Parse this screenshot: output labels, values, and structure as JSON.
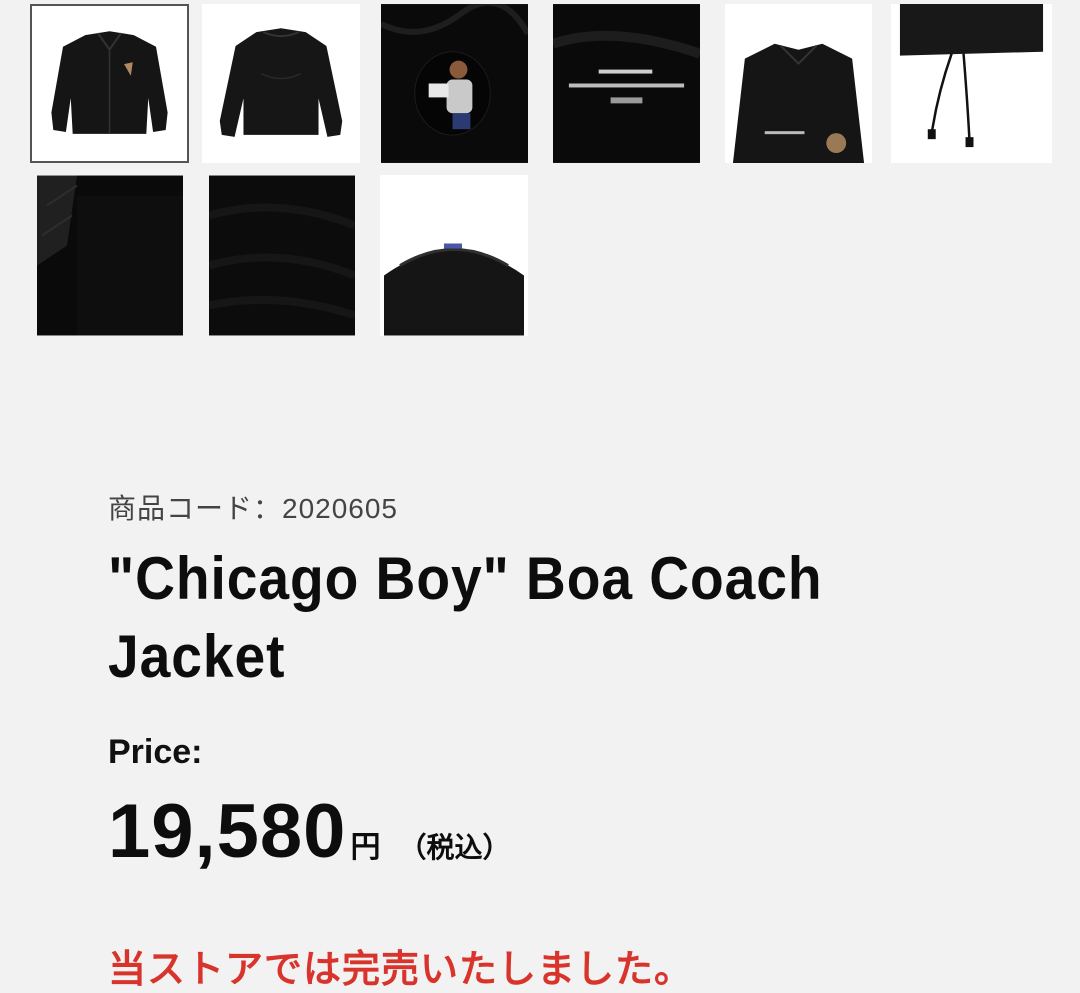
{
  "gallery": {
    "thumbnails": [
      {
        "name": "jacket-front",
        "background": "#ffffff",
        "selected": true
      },
      {
        "name": "jacket-back",
        "background": "#ffffff",
        "selected": false
      },
      {
        "name": "print-detail",
        "background": "#0a0a0a",
        "selected": false
      },
      {
        "name": "logo-detail",
        "background": "#0a0a0a",
        "selected": false
      },
      {
        "name": "front-print-detail",
        "background": "#ffffff",
        "selected": false
      },
      {
        "name": "drawcord-detail",
        "background": "#ffffff",
        "selected": false
      },
      {
        "name": "boa-lining-1",
        "background": "#0a0a0a",
        "selected": false
      },
      {
        "name": "boa-lining-2",
        "background": "#0a0a0a",
        "selected": false
      },
      {
        "name": "collar-lining",
        "background": "#ffffff",
        "selected": false
      }
    ]
  },
  "product": {
    "code_label": "商品コード：2020605",
    "title": "\"Chicago Boy\" Boa Coach Jacket",
    "price_label": "Price:",
    "price_value": "19,580",
    "price_unit": "円",
    "price_tax": "（税込）",
    "sold_out_message": "当ストアでは完売いたしました。"
  },
  "colors": {
    "background": "#f2f2f2",
    "text": "#111111",
    "sold_out": "#d8342c",
    "selected_border": "#555555"
  }
}
